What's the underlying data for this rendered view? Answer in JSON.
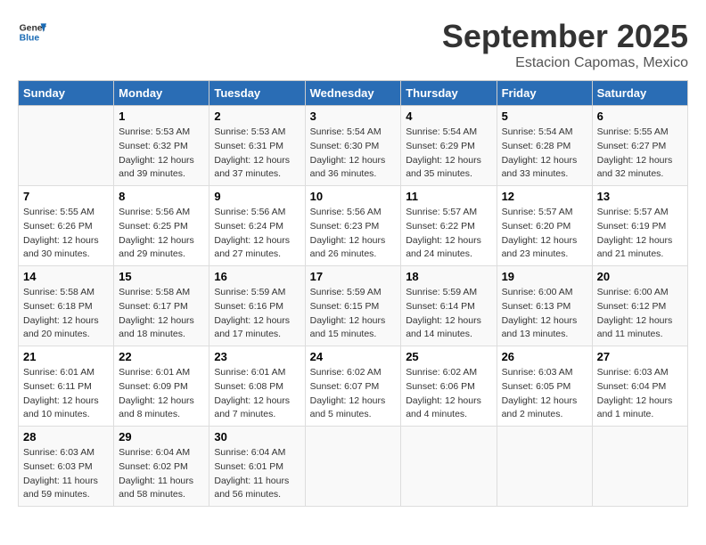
{
  "header": {
    "logo_line1": "General",
    "logo_line2": "Blue",
    "month": "September 2025",
    "location": "Estacion Capomas, Mexico"
  },
  "days_of_week": [
    "Sunday",
    "Monday",
    "Tuesday",
    "Wednesday",
    "Thursday",
    "Friday",
    "Saturday"
  ],
  "weeks": [
    [
      {
        "day": "",
        "info": ""
      },
      {
        "day": "1",
        "info": "Sunrise: 5:53 AM\nSunset: 6:32 PM\nDaylight: 12 hours\nand 39 minutes."
      },
      {
        "day": "2",
        "info": "Sunrise: 5:53 AM\nSunset: 6:31 PM\nDaylight: 12 hours\nand 37 minutes."
      },
      {
        "day": "3",
        "info": "Sunrise: 5:54 AM\nSunset: 6:30 PM\nDaylight: 12 hours\nand 36 minutes."
      },
      {
        "day": "4",
        "info": "Sunrise: 5:54 AM\nSunset: 6:29 PM\nDaylight: 12 hours\nand 35 minutes."
      },
      {
        "day": "5",
        "info": "Sunrise: 5:54 AM\nSunset: 6:28 PM\nDaylight: 12 hours\nand 33 minutes."
      },
      {
        "day": "6",
        "info": "Sunrise: 5:55 AM\nSunset: 6:27 PM\nDaylight: 12 hours\nand 32 minutes."
      }
    ],
    [
      {
        "day": "7",
        "info": "Sunrise: 5:55 AM\nSunset: 6:26 PM\nDaylight: 12 hours\nand 30 minutes."
      },
      {
        "day": "8",
        "info": "Sunrise: 5:56 AM\nSunset: 6:25 PM\nDaylight: 12 hours\nand 29 minutes."
      },
      {
        "day": "9",
        "info": "Sunrise: 5:56 AM\nSunset: 6:24 PM\nDaylight: 12 hours\nand 27 minutes."
      },
      {
        "day": "10",
        "info": "Sunrise: 5:56 AM\nSunset: 6:23 PM\nDaylight: 12 hours\nand 26 minutes."
      },
      {
        "day": "11",
        "info": "Sunrise: 5:57 AM\nSunset: 6:22 PM\nDaylight: 12 hours\nand 24 minutes."
      },
      {
        "day": "12",
        "info": "Sunrise: 5:57 AM\nSunset: 6:20 PM\nDaylight: 12 hours\nand 23 minutes."
      },
      {
        "day": "13",
        "info": "Sunrise: 5:57 AM\nSunset: 6:19 PM\nDaylight: 12 hours\nand 21 minutes."
      }
    ],
    [
      {
        "day": "14",
        "info": "Sunrise: 5:58 AM\nSunset: 6:18 PM\nDaylight: 12 hours\nand 20 minutes."
      },
      {
        "day": "15",
        "info": "Sunrise: 5:58 AM\nSunset: 6:17 PM\nDaylight: 12 hours\nand 18 minutes."
      },
      {
        "day": "16",
        "info": "Sunrise: 5:59 AM\nSunset: 6:16 PM\nDaylight: 12 hours\nand 17 minutes."
      },
      {
        "day": "17",
        "info": "Sunrise: 5:59 AM\nSunset: 6:15 PM\nDaylight: 12 hours\nand 15 minutes."
      },
      {
        "day": "18",
        "info": "Sunrise: 5:59 AM\nSunset: 6:14 PM\nDaylight: 12 hours\nand 14 minutes."
      },
      {
        "day": "19",
        "info": "Sunrise: 6:00 AM\nSunset: 6:13 PM\nDaylight: 12 hours\nand 13 minutes."
      },
      {
        "day": "20",
        "info": "Sunrise: 6:00 AM\nSunset: 6:12 PM\nDaylight: 12 hours\nand 11 minutes."
      }
    ],
    [
      {
        "day": "21",
        "info": "Sunrise: 6:01 AM\nSunset: 6:11 PM\nDaylight: 12 hours\nand 10 minutes."
      },
      {
        "day": "22",
        "info": "Sunrise: 6:01 AM\nSunset: 6:09 PM\nDaylight: 12 hours\nand 8 minutes."
      },
      {
        "day": "23",
        "info": "Sunrise: 6:01 AM\nSunset: 6:08 PM\nDaylight: 12 hours\nand 7 minutes."
      },
      {
        "day": "24",
        "info": "Sunrise: 6:02 AM\nSunset: 6:07 PM\nDaylight: 12 hours\nand 5 minutes."
      },
      {
        "day": "25",
        "info": "Sunrise: 6:02 AM\nSunset: 6:06 PM\nDaylight: 12 hours\nand 4 minutes."
      },
      {
        "day": "26",
        "info": "Sunrise: 6:03 AM\nSunset: 6:05 PM\nDaylight: 12 hours\nand 2 minutes."
      },
      {
        "day": "27",
        "info": "Sunrise: 6:03 AM\nSunset: 6:04 PM\nDaylight: 12 hours\nand 1 minute."
      }
    ],
    [
      {
        "day": "28",
        "info": "Sunrise: 6:03 AM\nSunset: 6:03 PM\nDaylight: 11 hours\nand 59 minutes."
      },
      {
        "day": "29",
        "info": "Sunrise: 6:04 AM\nSunset: 6:02 PM\nDaylight: 11 hours\nand 58 minutes."
      },
      {
        "day": "30",
        "info": "Sunrise: 6:04 AM\nSunset: 6:01 PM\nDaylight: 11 hours\nand 56 minutes."
      },
      {
        "day": "",
        "info": ""
      },
      {
        "day": "",
        "info": ""
      },
      {
        "day": "",
        "info": ""
      },
      {
        "day": "",
        "info": ""
      }
    ]
  ]
}
